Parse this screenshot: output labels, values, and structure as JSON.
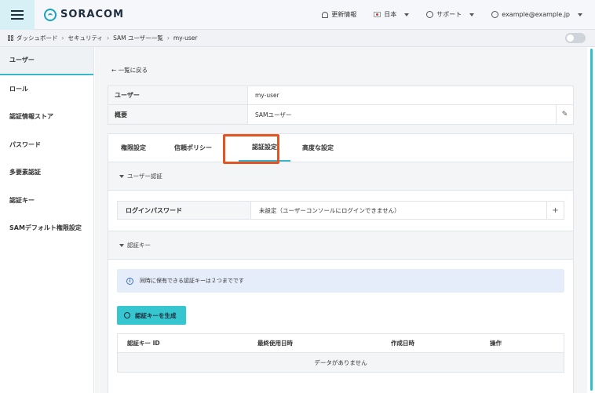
{
  "header": {
    "logo_text": "SORACOM",
    "updates_label": "更新情報",
    "language_label": "日本",
    "support_label": "サポート",
    "account_label": "example@example.jp"
  },
  "breadcrumb": {
    "items": [
      "ダッシュボード",
      "セキュリティ",
      "SAM ユーザー一覧",
      "my-user"
    ]
  },
  "sidebar": {
    "items": [
      {
        "label": "ユーザー"
      },
      {
        "label": "ロール"
      },
      {
        "label": "認証情報ストア"
      },
      {
        "label": "パスワード"
      },
      {
        "label": "多要素認証"
      },
      {
        "label": "認証キー"
      },
      {
        "label": "SAMデフォルト権限設定"
      }
    ]
  },
  "main": {
    "back_label": "← 一覧に戻る",
    "info": {
      "user_key": "ユーザー",
      "user_value": "my-user",
      "desc_key": "概要",
      "desc_value": "SAMユーザー"
    },
    "tabs": [
      {
        "label": "権限設定"
      },
      {
        "label": "信頼ポリシー"
      },
      {
        "label": "認証設定"
      },
      {
        "label": "高度な設定"
      }
    ],
    "user_auth": {
      "title": "ユーザー認証",
      "pw_key": "ログインパスワード",
      "pw_value": "未設定（ユーザーコンソールにログインできません）"
    },
    "auth_keys": {
      "title": "認証キー",
      "notice": "同時に保有できる認証キーは２つまでです",
      "generate_label": "認証キーを生成",
      "columns": [
        "認証キー ID",
        "最終使用日時",
        "作成日時",
        "操作"
      ],
      "empty_label": "データがありません"
    }
  },
  "colors": {
    "accent": "#38b7c9",
    "button": "#36c6cf",
    "highlight": "#e25423"
  }
}
